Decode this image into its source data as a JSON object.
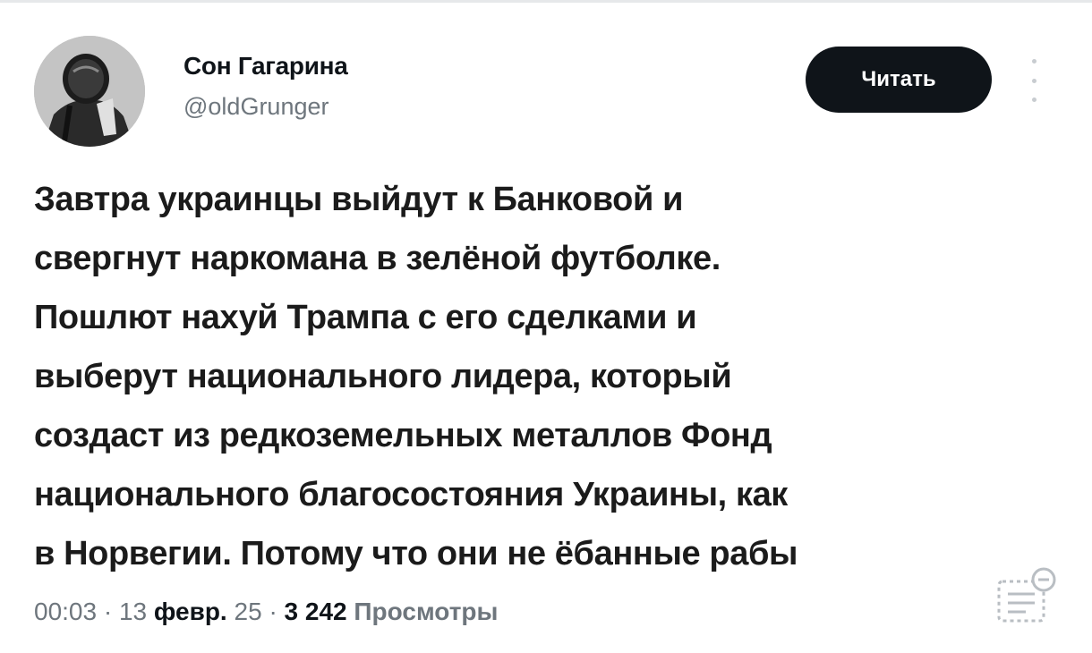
{
  "author": {
    "name": "Сон Гагарина",
    "handle": "@oldGrunger",
    "avatar_icon": "astronaut-avatar"
  },
  "actions": {
    "follow_label": "Читать",
    "more_icon": "more-vertical-icon"
  },
  "tweet": {
    "lines": [
      "Завтра украинцы выйдут к Банковой и",
      "свергнут наркомана в зелёной футболке.",
      "Пошлют нахуй Трампа с его сделками и",
      "выберут национального лидера, который",
      "создаст из редкоземельных металлов Фонд",
      "национального благосостояния Украины, как",
      "в Норвегии. Потому что они не ёбанные рабы"
    ]
  },
  "meta": {
    "time": "00:03",
    "separator": "·",
    "day": "13",
    "month": "февр.",
    "year": "25",
    "views_count": "3 242",
    "views_label": "Просмотры",
    "views_icon": "view-count-icon"
  },
  "colors": {
    "text": "#0f1419",
    "muted": "#6e767d",
    "button_bg": "#0f1419",
    "button_text": "#ffffff"
  }
}
